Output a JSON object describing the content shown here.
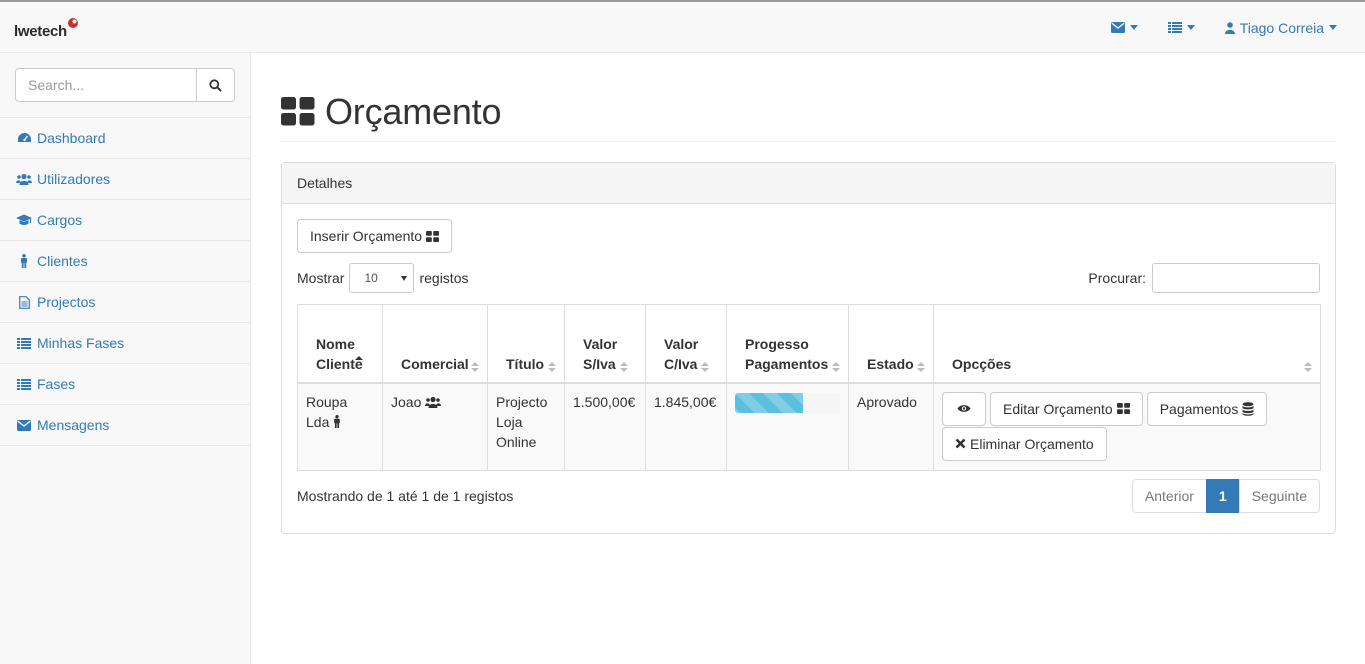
{
  "brand": {
    "name": "lwetech",
    "accent": "#c9302c"
  },
  "navbar": {
    "mail_icon": "envelope-icon",
    "tasks_icon": "tasks-icon",
    "user_name": "Tiago Correia"
  },
  "sidebar": {
    "search_placeholder": "Search...",
    "items": [
      {
        "label": "Dashboard",
        "icon": "dashboard-icon"
      },
      {
        "label": "Utilizadores",
        "icon": "users-icon"
      },
      {
        "label": "Cargos",
        "icon": "graduation-cap-icon"
      },
      {
        "label": "Clientes",
        "icon": "male-icon"
      },
      {
        "label": "Projectos",
        "icon": "file-icon"
      },
      {
        "label": "Minhas Fases",
        "icon": "list-icon"
      },
      {
        "label": "Fases",
        "icon": "list-icon"
      },
      {
        "label": "Mensagens",
        "icon": "envelope-icon"
      }
    ]
  },
  "page": {
    "title": "Orçamento"
  },
  "panel": {
    "heading": "Detalhes",
    "insert_button": "Inserir Orçamento",
    "show_label": "Mostrar",
    "page_size": "10",
    "records_label": "registos",
    "search_label": "Procurar:",
    "search_value": ""
  },
  "table": {
    "headers": {
      "cliente_1": "Nome",
      "cliente_2": "Cliente",
      "comercial": "Comercial",
      "titulo": "Título",
      "valor_s_1": "Valor",
      "valor_s_2": "S/Iva",
      "valor_c_1": "Valor",
      "valor_c_2": "C/Iva",
      "progresso_1": "Progesso",
      "progresso_2": "Pagamentos",
      "estado": "Estado",
      "opcoes": "Opcções"
    },
    "rows": [
      {
        "cliente_1": "Roupa",
        "cliente_2": "Lda",
        "comercial": "Joao",
        "titulo_1": "Projecto",
        "titulo_2": "Loja",
        "titulo_3": "Online",
        "valor_s_iva": "1.500,00€",
        "valor_c_iva": "1.845,00€",
        "progress_fraction": 0.65,
        "estado": "Aprovado",
        "btn_edit": "Editar Orçamento",
        "btn_payments": "Pagamentos",
        "btn_delete": "Eliminar Orçamento"
      }
    ]
  },
  "footer": {
    "info": "Mostrando de 1 até 1 de 1 registos",
    "prev": "Anterior",
    "current": "1",
    "next": "Seguinte"
  }
}
